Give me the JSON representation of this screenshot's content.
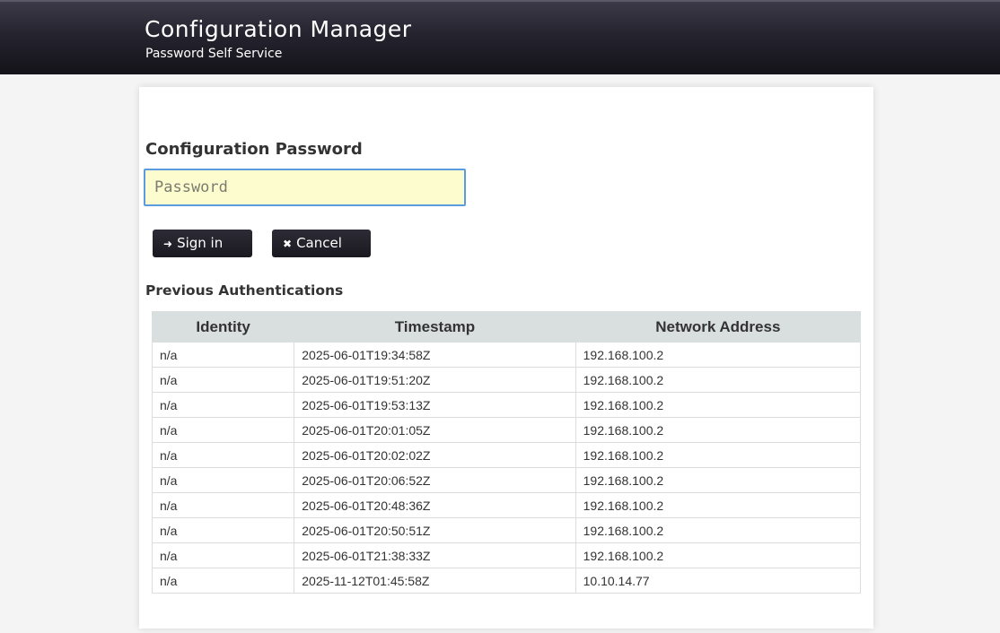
{
  "header": {
    "title": "Configuration Manager",
    "subtitle": "Password Self Service"
  },
  "form": {
    "section_title": "Configuration Password",
    "password_placeholder": "Password",
    "password_value": "",
    "signin_icon": "sign-in-icon",
    "signin_label": "Sign in",
    "cancel_icon": "close-icon",
    "cancel_label": "Cancel"
  },
  "auth_history": {
    "title": "Previous Authentications",
    "columns": [
      "Identity",
      "Timestamp",
      "Network Address"
    ],
    "rows": [
      [
        "n/a",
        "2025-06-01T19:34:58Z",
        "192.168.100.2"
      ],
      [
        "n/a",
        "2025-06-01T19:51:20Z",
        "192.168.100.2"
      ],
      [
        "n/a",
        "2025-06-01T19:53:13Z",
        "192.168.100.2"
      ],
      [
        "n/a",
        "2025-06-01T20:01:05Z",
        "192.168.100.2"
      ],
      [
        "n/a",
        "2025-06-01T20:02:02Z",
        "192.168.100.2"
      ],
      [
        "n/a",
        "2025-06-01T20:06:52Z",
        "192.168.100.2"
      ],
      [
        "n/a",
        "2025-06-01T20:48:36Z",
        "192.168.100.2"
      ],
      [
        "n/a",
        "2025-06-01T20:50:51Z",
        "192.168.100.2"
      ],
      [
        "n/a",
        "2025-06-01T21:38:33Z",
        "192.168.100.2"
      ],
      [
        "n/a",
        "2025-11-12T01:45:58Z",
        "10.10.14.77"
      ]
    ]
  }
}
